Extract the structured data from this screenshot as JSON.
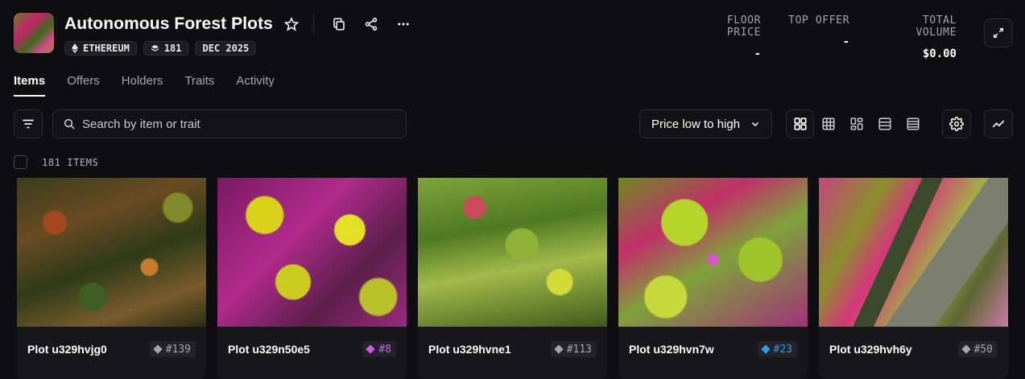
{
  "collection": {
    "title": "Autonomous Forest Plots",
    "badges": [
      {
        "icon": "ethereum-icon",
        "label": "ETHEREUM"
      },
      {
        "icon": "layers-icon",
        "label": "181"
      },
      {
        "icon": "",
        "label": "DEC 2025"
      }
    ]
  },
  "stats": [
    {
      "label": "FLOOR PRICE",
      "value": "-"
    },
    {
      "label": "TOP OFFER",
      "value": "-"
    },
    {
      "label": "TOTAL VOLUME",
      "value": "$0.00"
    }
  ],
  "tabs": [
    {
      "label": "Items",
      "active": true
    },
    {
      "label": "Offers",
      "active": false
    },
    {
      "label": "Holders",
      "active": false
    },
    {
      "label": "Traits",
      "active": false
    },
    {
      "label": "Activity",
      "active": false
    }
  ],
  "search": {
    "placeholder": "Search by item or trait"
  },
  "sort": {
    "label": "Price low to high"
  },
  "count": {
    "label": "181 ITEMS"
  },
  "cards": [
    {
      "name": "Plot u329hvjg0",
      "rank": "#139",
      "rank_color": "#a5a5aa",
      "gem_color": "#a5a5aa"
    },
    {
      "name": "Plot u329n50e5",
      "rank": "#8",
      "rank_color": "#d15ae6",
      "gem_color": "#d15ae6"
    },
    {
      "name": "Plot u329hvne1",
      "rank": "#113",
      "rank_color": "#a5a5aa",
      "gem_color": "#a5a5aa"
    },
    {
      "name": "Plot u329hvn7w",
      "rank": "#23",
      "rank_color": "#2f9cf0",
      "gem_color": "#2f9cf0"
    },
    {
      "name": "Plot u329hvh6y",
      "rank": "#50",
      "rank_color": "#a5a5aa",
      "gem_color": "#a5a5aa"
    }
  ],
  "colors": {
    "background": "#0e0e10",
    "panel": "#121214",
    "border": "#2c2c30"
  }
}
